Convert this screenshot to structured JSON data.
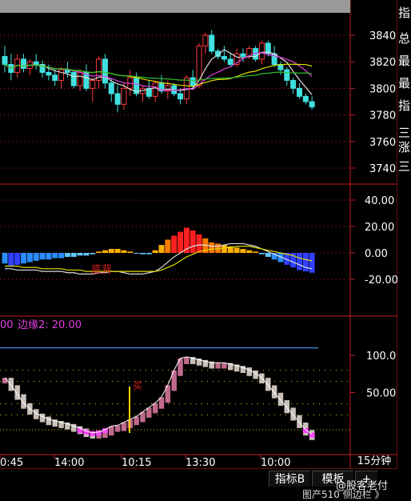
{
  "colors": {
    "background": "#000000",
    "grid_red": "#c81e1e",
    "axis_label": "#ffffff",
    "bull_candle": "#ff3b3b",
    "bear_candle": "#40e0e0",
    "ma_white": "#dddddd",
    "ma_yellow": "#e0e000",
    "ma_magenta": "#e040e0",
    "ma_green": "#30c030",
    "indicator_label_magenta": "#e040e0",
    "hist_pink": "#c06a8c",
    "hist_gray": "#c8c0b8",
    "hist_magenta": "#ff40ff",
    "signal_yellow": "#ffd000",
    "blue_line": "#4aa0ff"
  },
  "price_panel": {
    "axis_ticks": [
      "3840",
      "3820",
      "3800",
      "3780",
      "3760",
      "3740"
    ],
    "candles_ohlc": [
      [
        3824,
        3832,
        3812,
        3818
      ],
      [
        3818,
        3826,
        3806,
        3812
      ],
      [
        3812,
        3826,
        3808,
        3822
      ],
      [
        3822,
        3826,
        3812,
        3815
      ],
      [
        3815,
        3822,
        3810,
        3820
      ],
      [
        3820,
        3826,
        3814,
        3818
      ],
      [
        3818,
        3821,
        3808,
        3812
      ],
      [
        3812,
        3818,
        3806,
        3810
      ],
      [
        3810,
        3815,
        3802,
        3806
      ],
      [
        3806,
        3816,
        3800,
        3814
      ],
      [
        3814,
        3820,
        3808,
        3812
      ],
      [
        3812,
        3814,
        3800,
        3802
      ],
      [
        3802,
        3814,
        3798,
        3812
      ],
      [
        3812,
        3818,
        3798,
        3800
      ],
      [
        3800,
        3808,
        3790,
        3806
      ],
      [
        3806,
        3824,
        3800,
        3822
      ],
      [
        3822,
        3826,
        3800,
        3804
      ],
      [
        3804,
        3808,
        3790,
        3796
      ],
      [
        3796,
        3802,
        3782,
        3788
      ],
      [
        3788,
        3804,
        3784,
        3800
      ],
      [
        3800,
        3814,
        3794,
        3808
      ],
      [
        3808,
        3812,
        3794,
        3796
      ],
      [
        3796,
        3802,
        3790,
        3800
      ],
      [
        3800,
        3806,
        3792,
        3794
      ],
      [
        3794,
        3806,
        3790,
        3804
      ],
      [
        3804,
        3810,
        3796,
        3798
      ],
      [
        3798,
        3806,
        3792,
        3802
      ],
      [
        3802,
        3804,
        3794,
        3796
      ],
      [
        3796,
        3800,
        3788,
        3792
      ],
      [
        3792,
        3810,
        3788,
        3808
      ],
      [
        3808,
        3814,
        3800,
        3802
      ],
      [
        3802,
        3834,
        3800,
        3832
      ],
      [
        3832,
        3842,
        3826,
        3840
      ],
      [
        3840,
        3844,
        3826,
        3828
      ],
      [
        3828,
        3830,
        3822,
        3824
      ],
      [
        3824,
        3832,
        3820,
        3822
      ],
      [
        3822,
        3826,
        3816,
        3818
      ],
      [
        3818,
        3830,
        3816,
        3826
      ],
      [
        3826,
        3830,
        3820,
        3824
      ],
      [
        3824,
        3832,
        3822,
        3830
      ],
      [
        3830,
        3832,
        3820,
        3822
      ],
      [
        3822,
        3836,
        3818,
        3834
      ],
      [
        3834,
        3836,
        3824,
        3826
      ],
      [
        3826,
        3832,
        3816,
        3818
      ],
      [
        3818,
        3820,
        3810,
        3814
      ],
      [
        3814,
        3816,
        3802,
        3806
      ],
      [
        3806,
        3808,
        3796,
        3800
      ],
      [
        3800,
        3804,
        3792,
        3794
      ],
      [
        3794,
        3796,
        3788,
        3790
      ],
      [
        3790,
        3794,
        3784,
        3786
      ]
    ]
  },
  "macd_panel": {
    "axis_ticks": [
      "40.00",
      "20.00",
      "0.00",
      "-20.00"
    ],
    "annotation": "底背",
    "histogram": [
      -8,
      -10,
      -9,
      -8,
      -7,
      -6,
      -5,
      -5,
      -4,
      -4,
      -3,
      -3,
      -2,
      -2,
      -1,
      1,
      2,
      3,
      3,
      2,
      1,
      0,
      -1,
      -1,
      2,
      6,
      10,
      13,
      16,
      19,
      17,
      14,
      11,
      8,
      7,
      6,
      5,
      4,
      3,
      2,
      1,
      -1,
      -3,
      -5,
      -7,
      -9,
      -11,
      -13,
      -14,
      -15
    ],
    "dif": [
      -12,
      -12,
      -13,
      -13,
      -13,
      -13,
      -14,
      -14,
      -14,
      -14,
      -15,
      -15,
      -16,
      -16,
      -16,
      -15,
      -15,
      -14,
      -14,
      -15,
      -16,
      -16,
      -16,
      -15,
      -14,
      -11,
      -7,
      -3,
      0,
      3,
      5,
      6,
      6,
      5,
      5,
      6,
      7,
      7,
      7,
      6,
      5,
      3,
      1,
      -1,
      -3,
      -5,
      -7,
      -9,
      -11,
      -12
    ],
    "dea": [
      -10,
      -10,
      -10,
      -11,
      -11,
      -11,
      -12,
      -12,
      -12,
      -12,
      -13,
      -13,
      -13,
      -14,
      -14,
      -14,
      -14,
      -14,
      -14,
      -14,
      -14,
      -14,
      -14,
      -14,
      -14,
      -13,
      -11,
      -9,
      -6,
      -3,
      -1,
      1,
      2,
      3,
      3,
      4,
      4,
      5,
      5,
      5,
      4,
      3,
      2,
      1,
      0,
      -1,
      -2,
      -4,
      -5,
      -6
    ]
  },
  "osc_panel": {
    "label_prefix": "00",
    "label_text": "边缘2: 20.00",
    "axis_ticks": [
      "100.0",
      "50.00"
    ],
    "blue_line_level": 110,
    "annotation": "买",
    "bars": [
      [
        0,
        70
      ],
      [
        0,
        60
      ],
      [
        0,
        48
      ],
      [
        0,
        36
      ],
      [
        0,
        28
      ],
      [
        0,
        22
      ],
      [
        0,
        18
      ],
      [
        0,
        14
      ],
      [
        0,
        12
      ],
      [
        0,
        10
      ],
      [
        0,
        8
      ],
      [
        0,
        5
      ],
      [
        0,
        2
      ],
      [
        0,
        -2
      ],
      [
        0,
        -4
      ],
      [
        0,
        -3
      ],
      [
        0,
        0
      ],
      [
        0,
        5
      ],
      [
        0,
        6
      ],
      [
        0,
        10
      ],
      [
        0,
        14
      ],
      [
        0,
        18
      ],
      [
        0,
        24
      ],
      [
        0,
        30
      ],
      [
        0,
        36
      ],
      [
        0,
        44
      ],
      [
        0,
        60
      ],
      [
        0,
        80
      ],
      [
        0,
        96
      ],
      [
        0,
        98
      ],
      [
        0,
        96
      ],
      [
        0,
        94
      ],
      [
        0,
        92
      ],
      [
        0,
        90
      ],
      [
        0,
        90
      ],
      [
        0,
        90
      ],
      [
        0,
        88
      ],
      [
        0,
        86
      ],
      [
        0,
        84
      ],
      [
        0,
        80
      ],
      [
        0,
        76
      ],
      [
        0,
        70
      ],
      [
        0,
        60
      ],
      [
        0,
        50
      ],
      [
        0,
        40
      ],
      [
        0,
        30
      ],
      [
        0,
        20
      ],
      [
        0,
        10
      ],
      [
        0,
        0
      ],
      [
        0,
        -6
      ]
    ]
  },
  "time_axis": [
    "0:45",
    "14:00",
    "10:15",
    "13:30",
    "10:00"
  ],
  "interval": "15分钟",
  "sidebar_chars": [
    "指",
    "总",
    "最",
    "最",
    "指",
    "",
    "三",
    "涨",
    "三"
  ],
  "bottom_buttons": [
    "指标B",
    "模板",
    "+"
  ],
  "bottom_cut_text": "图产510 侧边栏 》",
  "watermark": "@股客老付"
}
